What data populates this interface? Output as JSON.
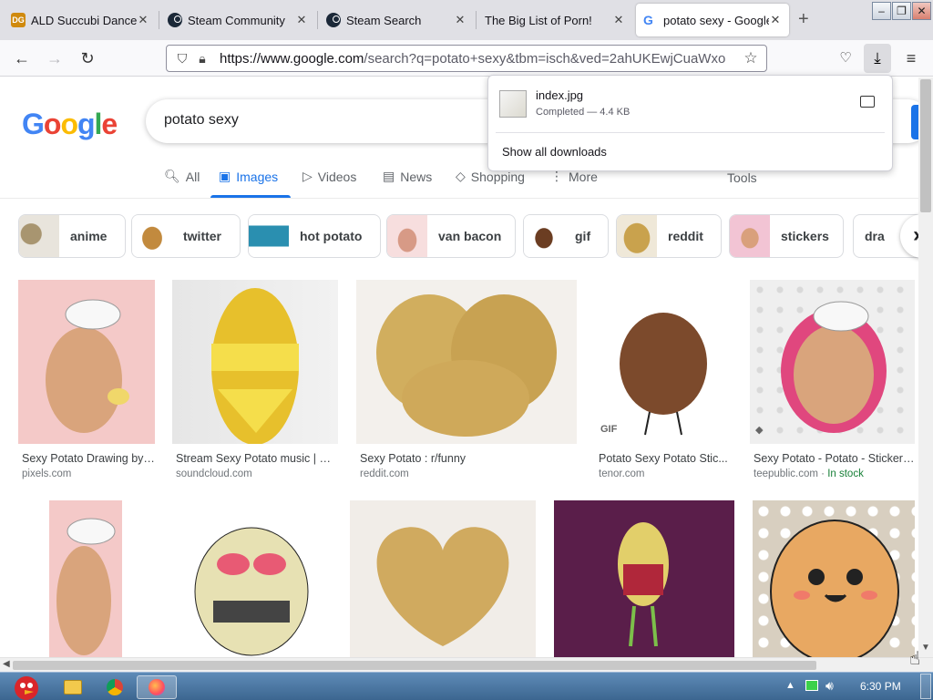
{
  "browser": {
    "tabs": [
      {
        "title": "ALD Succubi Dance",
        "favicon": "ald-favicon"
      },
      {
        "title": "Steam Community",
        "favicon": "steam-icon"
      },
      {
        "title": "Steam Search",
        "favicon": "steam-icon"
      },
      {
        "title": "The Big List of Porn!",
        "favicon": ""
      },
      {
        "title": "potato sexy - Google",
        "favicon": "google-icon"
      }
    ],
    "active_tab": 4,
    "new_tab_label": "+",
    "url_host": "https://www.google.com",
    "url_path": "/search?q=potato+sexy&tbm=isch&ved=2ahUKEwjCuaWxo"
  },
  "downloads": {
    "file_name": "index.jpg",
    "status": "Completed — 4.4 KB",
    "show_all_label": "Show all downloads"
  },
  "google": {
    "logo": "Google",
    "query": "potato sexy",
    "nav_tabs": [
      "All",
      "Images",
      "Videos",
      "News",
      "Shopping",
      "More"
    ],
    "active_nav_tab": "Images",
    "tools_label": "Tools",
    "chips": [
      "anime",
      "twitter",
      "hot potato",
      "van bacon",
      "gif",
      "reddit",
      "stickers",
      "dra"
    ],
    "results_row1": [
      {
        "title": "Sexy Potato Drawing by ...",
        "source": "pixels.com"
      },
      {
        "title": "Stream Sexy Potato music | Li...",
        "source": "soundcloud.com"
      },
      {
        "title": "Sexy Potato : r/funny",
        "source": "reddit.com"
      },
      {
        "title": "Potato Sexy Potato Stic...",
        "source": "tenor.com",
        "badge": "GIF"
      },
      {
        "title": "Sexy Potato - Potato - Sticker ...",
        "source": "teepublic.com",
        "stock": "In stock"
      }
    ]
  },
  "taskbar": {
    "clock": "6:30 PM"
  },
  "colors": {
    "accent": "#1a73e8",
    "in_stock": "#188038"
  }
}
